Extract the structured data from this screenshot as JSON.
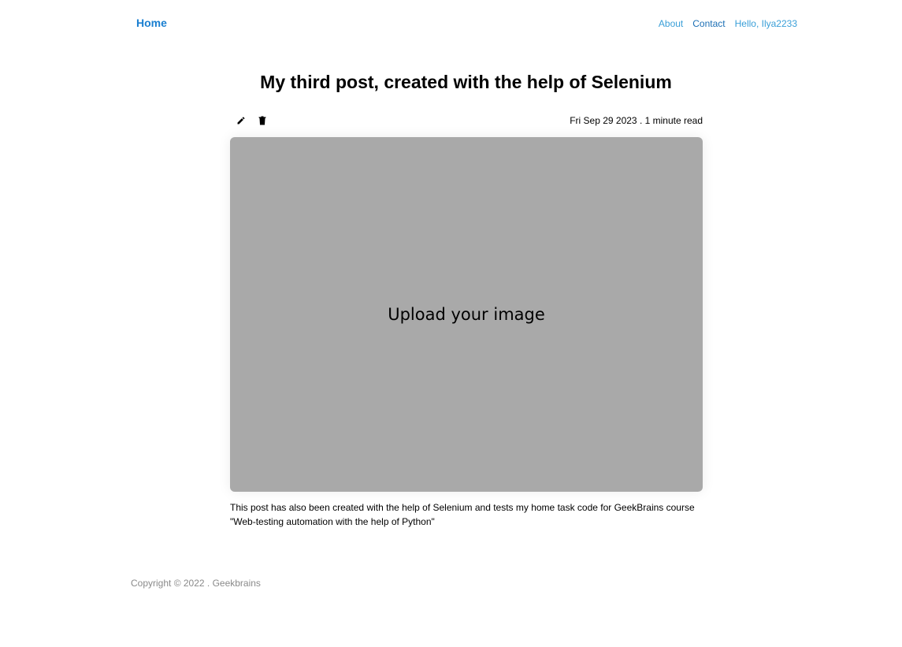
{
  "header": {
    "home_label": "Home",
    "about_label": "About",
    "contact_label": "Contact",
    "user_greeting": "Hello, Ilya2233"
  },
  "post": {
    "title": "My third post, created with the help of Selenium",
    "date_read": "Fri Sep 29 2023 . 1 minute read",
    "image_placeholder": "Upload your image",
    "body": "This post has also been created with the help of Selenium and tests my home task code for GeekBrains course \"Web-testing automation with the help of Python\"",
    "edit_icon": "pencil-icon",
    "delete_icon": "trash-icon"
  },
  "footer": {
    "copyright": "Copyright © 2022 . Geekbrains"
  },
  "colors": {
    "accent": "#1a7fd0",
    "link": "#3a9fd8",
    "image_bg": "#a9a9a9",
    "muted": "#8a8a8a"
  }
}
